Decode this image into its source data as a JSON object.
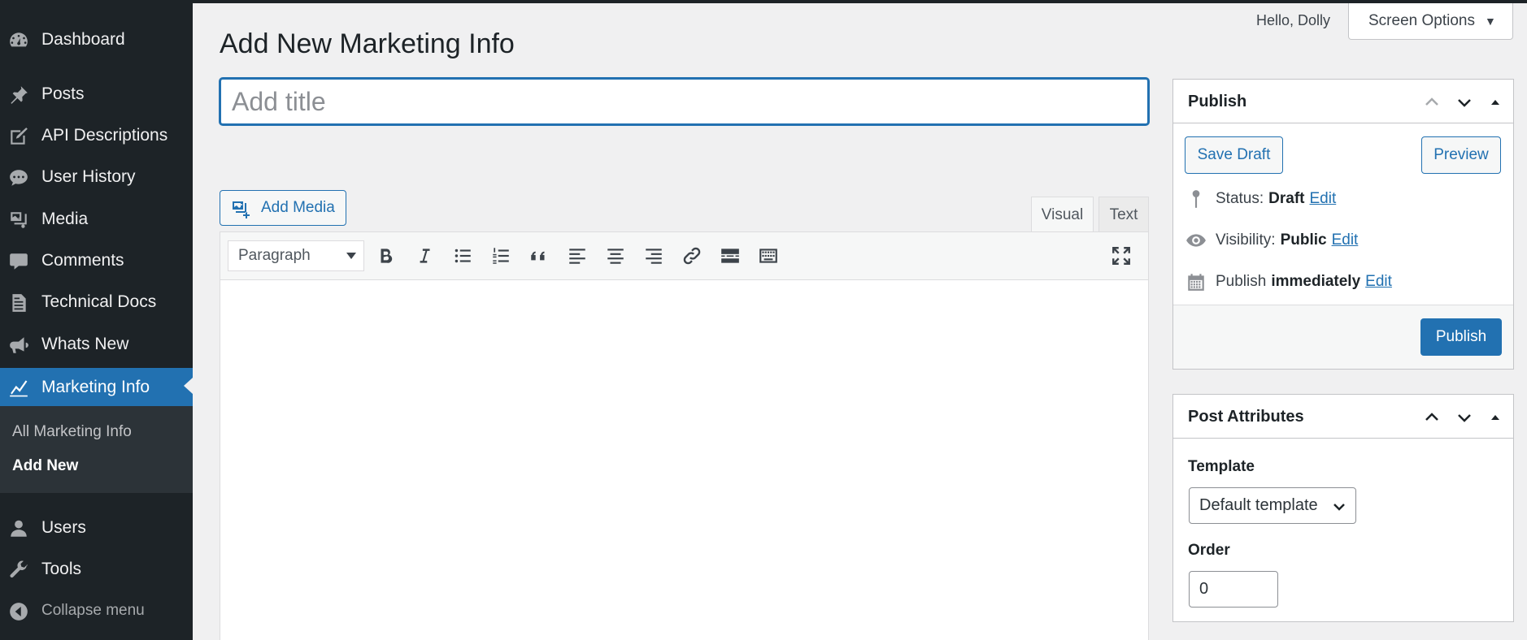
{
  "sidebar": {
    "items": [
      {
        "label": "Dashboard",
        "icon": "dashboard-icon"
      },
      {
        "label": "Posts",
        "icon": "pin-icon"
      },
      {
        "label": "API Descriptions",
        "icon": "edit-icon"
      },
      {
        "label": "User History",
        "icon": "chat-bubbles-icon"
      },
      {
        "label": "Media",
        "icon": "media-icon"
      },
      {
        "label": "Comments",
        "icon": "comment-icon"
      },
      {
        "label": "Technical Docs",
        "icon": "document-icon"
      },
      {
        "label": "Whats New",
        "icon": "megaphone-icon"
      },
      {
        "label": "Marketing Info",
        "icon": "chart-line-icon",
        "active": true
      },
      {
        "label": "Users",
        "icon": "user-icon"
      },
      {
        "label": "Tools",
        "icon": "wrench-icon"
      }
    ],
    "submenu": [
      {
        "label": "All Marketing Info"
      },
      {
        "label": "Add New",
        "current": true
      }
    ],
    "collapse_label": "Collapse menu"
  },
  "topbar": {
    "greeting": "Hello, Dolly",
    "screen_options": "Screen Options"
  },
  "page": {
    "title": "Add New Marketing Info",
    "title_placeholder": "Add title"
  },
  "editor": {
    "add_media": "Add Media",
    "tabs": {
      "visual": "Visual",
      "text": "Text"
    },
    "format": "Paragraph",
    "toolbar_icons": [
      "bold-icon",
      "italic-icon",
      "bullet-list-icon",
      "numbered-list-icon",
      "blockquote-icon",
      "align-left-icon",
      "align-center-icon",
      "align-right-icon",
      "link-icon",
      "read-more-icon",
      "toolbar-toggle-icon",
      "fullscreen-icon"
    ]
  },
  "publish": {
    "title": "Publish",
    "save_draft": "Save Draft",
    "preview": "Preview",
    "status_label": "Status:",
    "status_value": "Draft",
    "visibility_label": "Visibility:",
    "visibility_value": "Public",
    "schedule_label": "Publish",
    "schedule_value": "immediately",
    "edit": "Edit",
    "publish_button": "Publish"
  },
  "attributes": {
    "title": "Post Attributes",
    "template_label": "Template",
    "template_value": "Default template",
    "order_label": "Order",
    "order_value": "0"
  },
  "colors": {
    "sidebar_bg": "#1d2327",
    "accent": "#2271b1",
    "page_bg": "#f0f0f1"
  }
}
